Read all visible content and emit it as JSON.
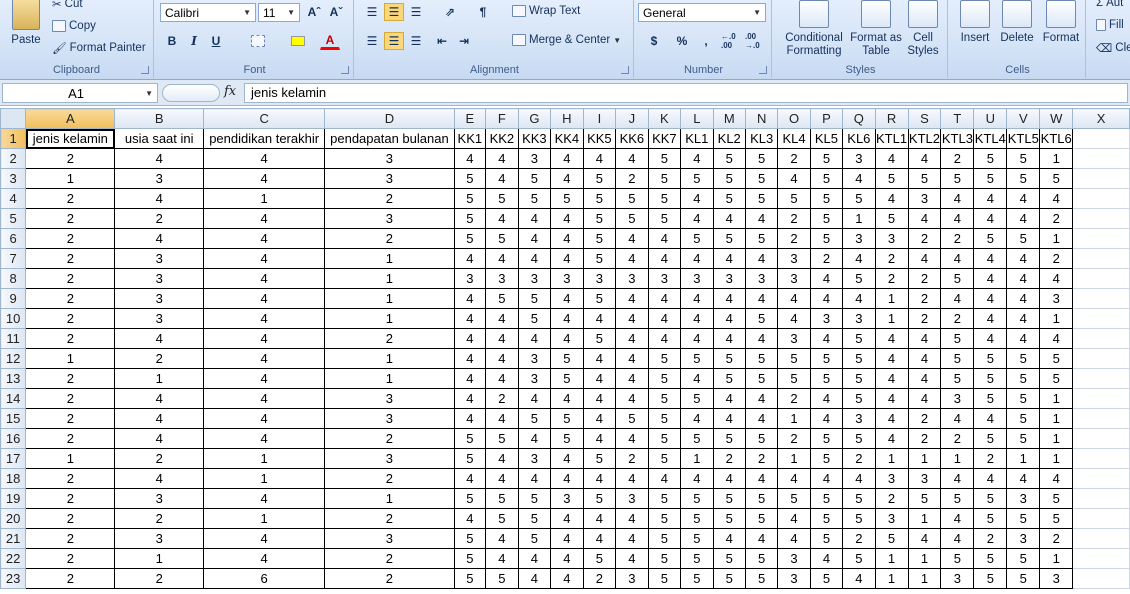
{
  "ribbon": {
    "clipboard": {
      "label": "Clipboard",
      "paste": "Paste",
      "cut": "Cut",
      "copy": "Copy",
      "format_painter": "Format Painter"
    },
    "font": {
      "label": "Font",
      "font_name": "Calibri",
      "font_size": "11",
      "bold": "B",
      "italic": "I",
      "underline": "U",
      "grow": "Aˆ",
      "shrink": "Aˇ",
      "font_color": "A"
    },
    "alignment": {
      "label": "Alignment",
      "wrap_text": "Wrap Text",
      "merge_center": "Merge & Center"
    },
    "number": {
      "label": "Number",
      "format": "General",
      "currency": "$",
      "percent": "%",
      "comma": ",",
      "inc_decimal": "←.0 .00",
      "dec_decimal": ".00 →.0"
    },
    "styles": {
      "label": "Styles",
      "conditional": "Conditional Formatting",
      "format_table": "Format as Table",
      "cell_styles": "Cell Styles"
    },
    "cells": {
      "label": "Cells",
      "insert": "Insert",
      "delete": "Delete",
      "format": "Format"
    },
    "editing": {
      "autosum": "Aut",
      "fill": "Fill",
      "clear": "Cle"
    }
  },
  "formula_bar": {
    "name_box": "A1",
    "fx": "fx",
    "formula": "jenis kelamin"
  },
  "sheet": {
    "columns": [
      "A",
      "B",
      "C",
      "D",
      "E",
      "F",
      "G",
      "H",
      "I",
      "J",
      "K",
      "L",
      "M",
      "N",
      "O",
      "P",
      "Q",
      "R",
      "S",
      "T",
      "U",
      "V",
      "W",
      "X"
    ],
    "headers": [
      "jenis kelamin",
      "usia saat ini",
      "pendidikan terakhir",
      "pendapatan bulanan",
      "KK1",
      "KK2",
      "KK3",
      "KK4",
      "KK5",
      "KK6",
      "KK7",
      "KL1",
      "KL2",
      "KL3",
      "KL4",
      "KL5",
      "KL6",
      "KTL1",
      "KTL2",
      "KTL3",
      "KTL4",
      "KTL5",
      "KTL6"
    ],
    "rows": [
      [
        2,
        4,
        4,
        3,
        4,
        4,
        3,
        4,
        4,
        4,
        5,
        4,
        5,
        5,
        2,
        5,
        3,
        4,
        4,
        2,
        5,
        5,
        1
      ],
      [
        1,
        3,
        4,
        3,
        5,
        4,
        5,
        4,
        5,
        2,
        5,
        5,
        5,
        5,
        4,
        5,
        4,
        5,
        5,
        5,
        5,
        5,
        5
      ],
      [
        2,
        4,
        1,
        2,
        5,
        5,
        5,
        5,
        5,
        5,
        5,
        4,
        5,
        5,
        5,
        5,
        5,
        4,
        3,
        4,
        4,
        4,
        4
      ],
      [
        2,
        2,
        4,
        3,
        5,
        4,
        4,
        4,
        5,
        5,
        5,
        4,
        4,
        4,
        2,
        5,
        1,
        5,
        4,
        4,
        4,
        4,
        2
      ],
      [
        2,
        4,
        4,
        2,
        5,
        5,
        4,
        4,
        5,
        4,
        4,
        5,
        5,
        5,
        2,
        5,
        3,
        3,
        2,
        2,
        5,
        5,
        1
      ],
      [
        2,
        3,
        4,
        1,
        4,
        4,
        4,
        4,
        5,
        4,
        4,
        4,
        4,
        4,
        3,
        2,
        4,
        2,
        4,
        4,
        4,
        4,
        2
      ],
      [
        2,
        3,
        4,
        1,
        3,
        3,
        3,
        3,
        3,
        3,
        3,
        3,
        3,
        3,
        3,
        4,
        5,
        2,
        2,
        5,
        4,
        4,
        4
      ],
      [
        2,
        3,
        4,
        1,
        4,
        5,
        5,
        4,
        5,
        4,
        4,
        4,
        4,
        4,
        4,
        4,
        4,
        1,
        2,
        4,
        4,
        4,
        3
      ],
      [
        2,
        3,
        4,
        1,
        4,
        4,
        5,
        4,
        4,
        4,
        4,
        4,
        4,
        5,
        4,
        3,
        3,
        1,
        2,
        2,
        4,
        4,
        1
      ],
      [
        2,
        4,
        4,
        2,
        4,
        4,
        4,
        4,
        5,
        4,
        4,
        4,
        4,
        4,
        3,
        4,
        5,
        4,
        4,
        5,
        4,
        4,
        4
      ],
      [
        1,
        2,
        4,
        1,
        4,
        4,
        3,
        5,
        4,
        4,
        5,
        5,
        5,
        5,
        5,
        5,
        5,
        4,
        4,
        5,
        5,
        5,
        5
      ],
      [
        2,
        1,
        4,
        1,
        4,
        4,
        3,
        5,
        4,
        4,
        5,
        4,
        5,
        5,
        5,
        5,
        5,
        4,
        4,
        5,
        5,
        5,
        5
      ],
      [
        2,
        4,
        4,
        3,
        4,
        2,
        4,
        4,
        4,
        4,
        5,
        5,
        4,
        4,
        2,
        4,
        5,
        4,
        4,
        3,
        5,
        5,
        1
      ],
      [
        2,
        4,
        4,
        3,
        4,
        4,
        5,
        5,
        4,
        5,
        5,
        4,
        4,
        4,
        1,
        4,
        3,
        4,
        2,
        4,
        4,
        5,
        1
      ],
      [
        2,
        4,
        4,
        2,
        5,
        5,
        4,
        5,
        4,
        4,
        5,
        5,
        5,
        5,
        2,
        5,
        5,
        4,
        2,
        2,
        5,
        5,
        1
      ],
      [
        1,
        2,
        1,
        3,
        5,
        4,
        3,
        4,
        5,
        2,
        5,
        1,
        2,
        2,
        1,
        5,
        2,
        1,
        1,
        1,
        2,
        1,
        1
      ],
      [
        2,
        4,
        1,
        2,
        4,
        4,
        4,
        4,
        4,
        4,
        4,
        4,
        4,
        4,
        4,
        4,
        4,
        3,
        3,
        4,
        4,
        4,
        4
      ],
      [
        2,
        3,
        4,
        1,
        5,
        5,
        5,
        3,
        5,
        3,
        5,
        5,
        5,
        5,
        5,
        5,
        5,
        2,
        5,
        5,
        5,
        3,
        5
      ],
      [
        2,
        2,
        1,
        2,
        4,
        5,
        5,
        4,
        4,
        4,
        5,
        5,
        5,
        5,
        4,
        5,
        5,
        3,
        1,
        4,
        5,
        5,
        5
      ],
      [
        2,
        3,
        4,
        3,
        5,
        4,
        5,
        4,
        4,
        4,
        5,
        5,
        4,
        4,
        4,
        5,
        2,
        5,
        4,
        4,
        2,
        3,
        2
      ],
      [
        2,
        1,
        4,
        2,
        5,
        4,
        4,
        4,
        5,
        4,
        5,
        5,
        5,
        5,
        3,
        4,
        5,
        1,
        1,
        5,
        5,
        5,
        1
      ],
      [
        2,
        2,
        6,
        2,
        5,
        5,
        4,
        4,
        2,
        3,
        5,
        5,
        5,
        5,
        3,
        5,
        4,
        1,
        1,
        3,
        5,
        5,
        3
      ]
    ]
  }
}
